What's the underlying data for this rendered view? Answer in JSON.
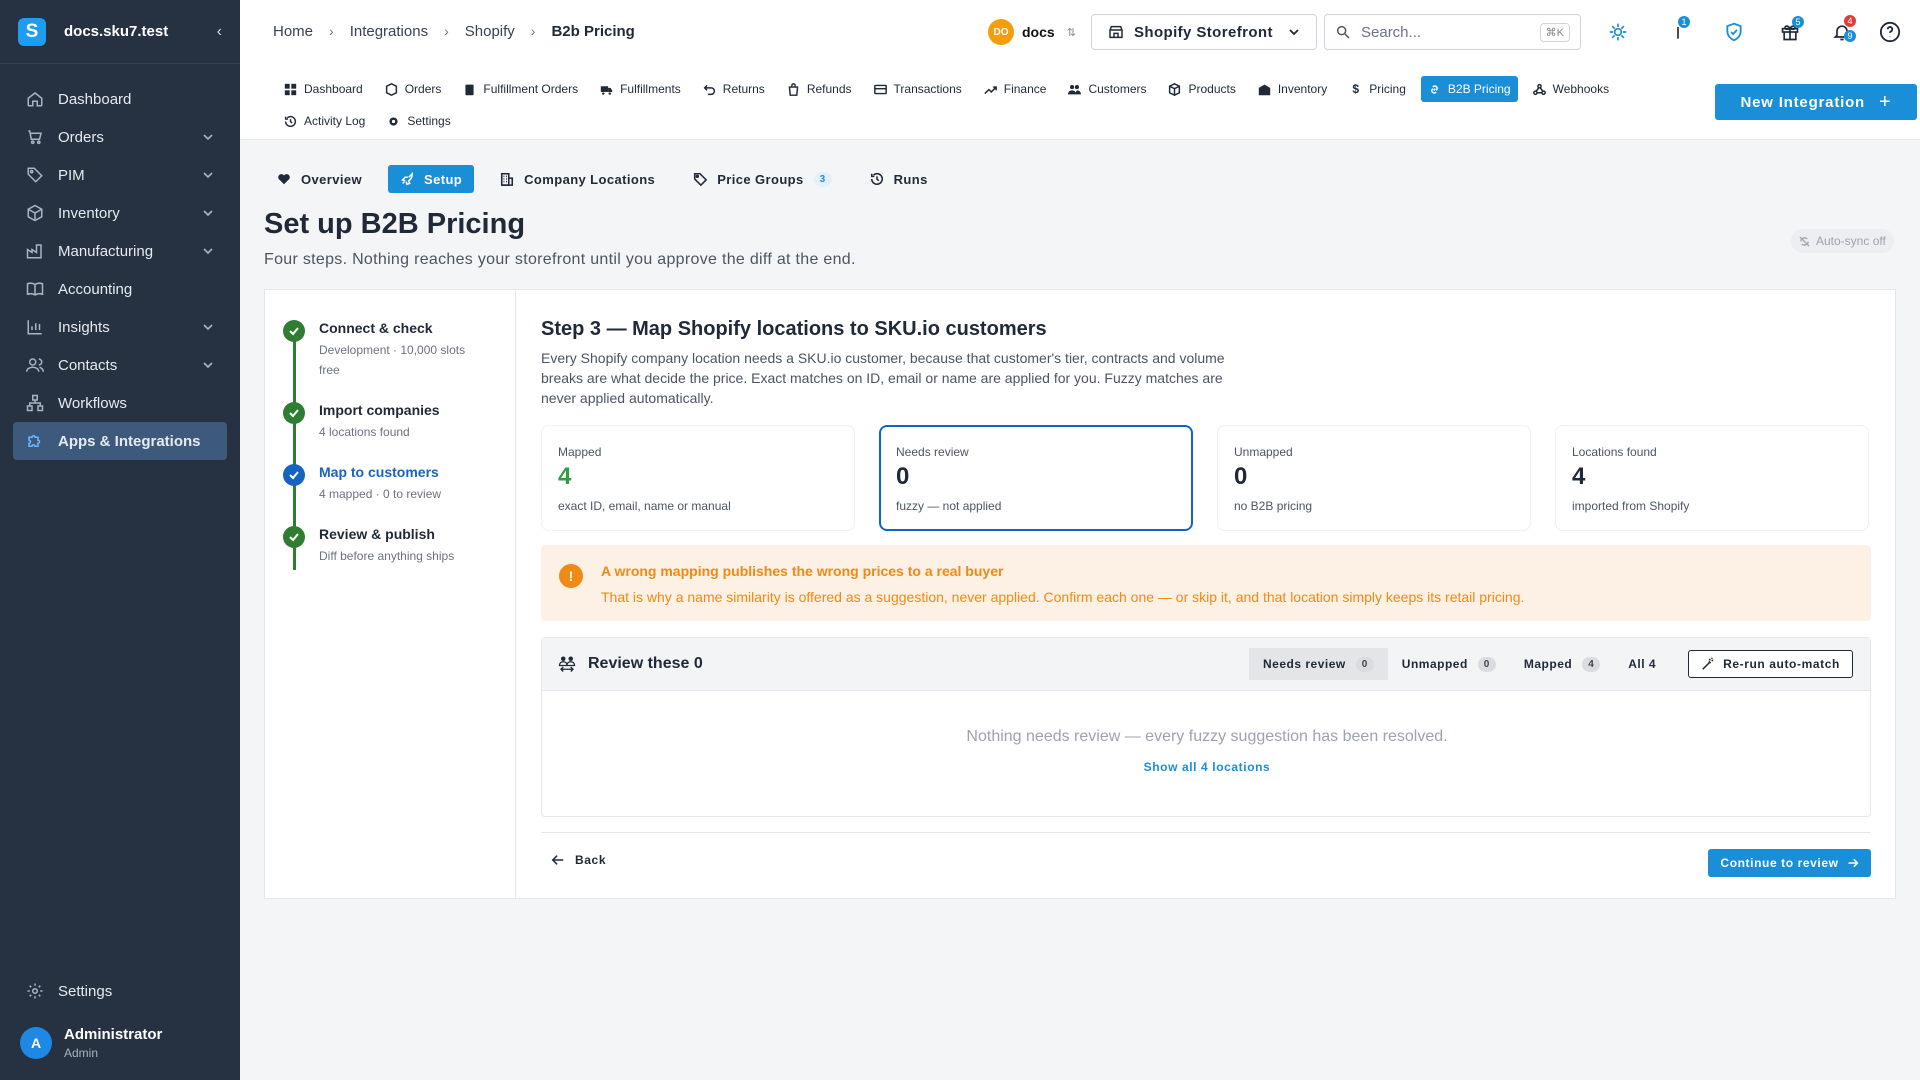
{
  "sidebar": {
    "org_name": "docs.sku7.test",
    "logo_letter": "S",
    "items": [
      {
        "label": "Dashboard",
        "icon": "home-icon"
      },
      {
        "label": "Orders",
        "icon": "cart-icon"
      },
      {
        "label": "PIM",
        "icon": "tag-icon"
      },
      {
        "label": "Inventory",
        "icon": "box-icon"
      },
      {
        "label": "Manufacturing",
        "icon": "factory-icon"
      },
      {
        "label": "Accounting",
        "icon": "book-icon"
      },
      {
        "label": "Insights",
        "icon": "chart-icon"
      },
      {
        "label": "Contacts",
        "icon": "users-icon"
      },
      {
        "label": "Workflows",
        "icon": "workflow-icon"
      },
      {
        "label": "Apps & Integrations",
        "icon": "puzzle-icon"
      }
    ],
    "settings_label": "Settings",
    "user": {
      "initial": "A",
      "name": "Administrator",
      "role": "Admin"
    }
  },
  "breadcrumb": [
    "Home",
    "Integrations",
    "Shopify",
    "B2b Pricing"
  ],
  "workspace": {
    "badge": "DO",
    "name": "docs"
  },
  "store_selector": {
    "label": "Shopify Storefront"
  },
  "search": {
    "placeholder": "Search...",
    "shortcut": "⌘K"
  },
  "topbar_badges": {
    "updates": "1",
    "gifts": "5",
    "notif_red": "4",
    "notif_blue": "9"
  },
  "subnav": [
    "Dashboard",
    "Orders",
    "Fulfillment Orders",
    "Fulfillments",
    "Returns",
    "Refunds",
    "Transactions",
    "Finance",
    "Customers",
    "Products",
    "Inventory",
    "Pricing",
    "B2B Pricing",
    "Webhooks",
    "Activity Log",
    "Settings"
  ],
  "new_integration_label": "New Integration",
  "tabs": [
    {
      "label": "Overview"
    },
    {
      "label": "Setup"
    },
    {
      "label": "Company Locations"
    },
    {
      "label": "Price Groups",
      "count": "3"
    },
    {
      "label": "Runs"
    }
  ],
  "page": {
    "title": "Set up B2B Pricing",
    "subtitle": "Four steps. Nothing reaches your storefront until you approve the diff at the end.",
    "autosync": "Auto-sync off"
  },
  "steps": [
    {
      "title": "Connect & check",
      "sub": "Development · 10,000 slots free",
      "state": "done"
    },
    {
      "title": "Import companies",
      "sub": "4 locations found",
      "state": "done"
    },
    {
      "title": "Map to customers",
      "sub": "4 mapped · 0 to review",
      "state": "current"
    },
    {
      "title": "Review & publish",
      "sub": "Diff before anything ships",
      "state": "done"
    }
  ],
  "step3": {
    "title": "Step 3 — Map Shopify locations to SKU.io customers",
    "description": "Every Shopify company location needs a SKU.io customer, because that customer's tier, contracts and volume breaks are what decide the price. Exact matches on ID, email or name are applied for you. Fuzzy matches are never applied automatically."
  },
  "stats": [
    {
      "label": "Mapped",
      "value": "4",
      "hint": "exact ID, email, name or manual"
    },
    {
      "label": "Needs review",
      "value": "0",
      "hint": "fuzzy — not applied"
    },
    {
      "label": "Unmapped",
      "value": "0",
      "hint": "no B2B pricing"
    },
    {
      "label": "Locations found",
      "value": "4",
      "hint": "imported from Shopify"
    }
  ],
  "warning": {
    "title": "A wrong mapping publishes the wrong prices to a real buyer",
    "body": "That is why a name similarity is offered as a suggestion, never applied. Confirm each one — or skip it, and that location simply keeps its retail pricing."
  },
  "review": {
    "title": "Review these 0",
    "filters": [
      {
        "label": "Needs review",
        "count": "0"
      },
      {
        "label": "Unmapped",
        "count": "0"
      },
      {
        "label": "Mapped",
        "count": "4"
      },
      {
        "label": "All 4"
      }
    ],
    "rerun_label": "Re-run auto-match",
    "empty_text": "Nothing needs review — every fuzzy suggestion has been resolved.",
    "show_all_label": "Show all 4 locations"
  },
  "footer": {
    "back_label": "Back",
    "continue_label": "Continue to review"
  },
  "colors": {
    "sidebar_bg": "#263241",
    "accent": "#1a8fd8",
    "success": "#2e7d32",
    "warning": "#ef8a14",
    "current_step": "#1565c0"
  }
}
